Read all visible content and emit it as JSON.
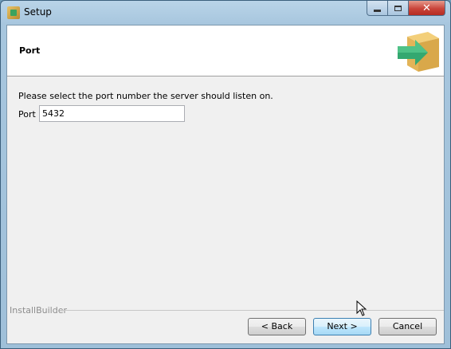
{
  "window": {
    "title": "Setup"
  },
  "header": {
    "page_title": "Port"
  },
  "content": {
    "instruction": "Please select the port number the server should listen on.",
    "port_label": "Port",
    "port_value": "5432"
  },
  "footer": {
    "brand": "InstallBuilder",
    "back_label": "< Back",
    "next_label": "Next >",
    "cancel_label": "Cancel"
  },
  "icons": {
    "app": "installer-box-icon",
    "logo": "box-arrow-icon",
    "minimize": "minimize-icon",
    "maximize": "maximize-icon",
    "close": "close-icon"
  }
}
